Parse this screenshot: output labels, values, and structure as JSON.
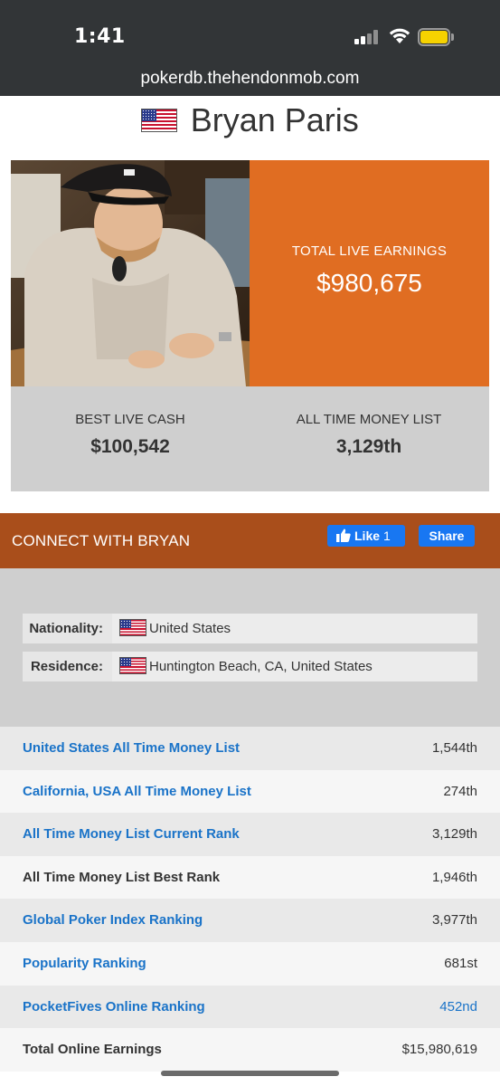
{
  "status_bar": {
    "time": "1:41",
    "battery_color": "#f6d200"
  },
  "browser": {
    "url": "pokerdb.thehendonmob.com"
  },
  "player": {
    "name": "Bryan Paris",
    "flag_icon": "us-flag-icon",
    "photo_alt": "Player photo"
  },
  "earnings": {
    "total_label": "TOTAL LIVE EARNINGS",
    "total_value": "$980,675",
    "best_cash_label": "BEST LIVE CASH",
    "best_cash_value": "$100,542",
    "money_list_label": "ALL TIME MONEY LIST",
    "money_list_value": "3,129th"
  },
  "connect": {
    "title": "CONNECT WITH BRYAN",
    "like_label": "Like",
    "like_count": "1",
    "share_label": "Share"
  },
  "info": {
    "nationality_label": "Nationality:",
    "nationality_value": "United States",
    "residence_label": "Residence:",
    "residence_value": "Huntington Beach, CA, United States"
  },
  "rankings": [
    {
      "label": "United States All Time Money List",
      "value": "1,544th",
      "label_link": true,
      "value_link": false
    },
    {
      "label": "California, USA All Time Money List",
      "value": "274th",
      "label_link": true,
      "value_link": false
    },
    {
      "label": "All Time Money List Current Rank",
      "value": "3,129th",
      "label_link": true,
      "value_link": false
    },
    {
      "label": "All Time Money List Best Rank",
      "value": "1,946th",
      "label_link": false,
      "value_link": false
    },
    {
      "label": "Global Poker Index Ranking",
      "value": "3,977th",
      "label_link": true,
      "value_link": false
    },
    {
      "label": "Popularity Ranking",
      "value": "681st",
      "label_link": true,
      "value_link": false
    },
    {
      "label": "PocketFives Online Ranking",
      "value": "452nd",
      "label_link": true,
      "value_link": true
    },
    {
      "label": "Total Online Earnings",
      "value": "$15,980,619",
      "label_link": false,
      "value_link": false
    }
  ],
  "colors": {
    "topbar": "#323537",
    "accent_orange": "#e06d22",
    "connect_bar": "#a94e1b",
    "link_blue": "#1a73c8",
    "facebook_blue": "#1877f2"
  }
}
